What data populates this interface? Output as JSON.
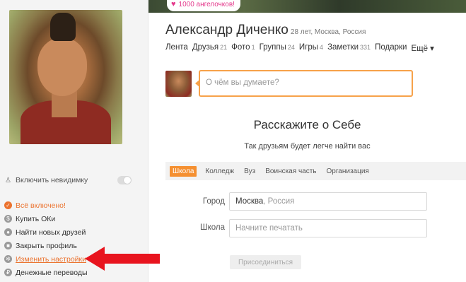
{
  "banner": {
    "badge_label": "1000 ангелочков!"
  },
  "profile": {
    "name": "Александр Диченко",
    "meta": "28 лет, Москва, Россия"
  },
  "nav": {
    "tabs": [
      {
        "label": "Лента",
        "count": ""
      },
      {
        "label": "Друзья",
        "count": "21"
      },
      {
        "label": "Фото",
        "count": "1"
      },
      {
        "label": "Группы",
        "count": "24"
      },
      {
        "label": "Игры",
        "count": "4"
      },
      {
        "label": "Заметки",
        "count": "331"
      },
      {
        "label": "Подарки",
        "count": ""
      },
      {
        "label": "Ещё ▾",
        "count": ""
      }
    ]
  },
  "status": {
    "placeholder": "О чём вы думаете?"
  },
  "sidebar": {
    "invisible_label": "Включить невидимку",
    "menu": [
      {
        "label": "Всё включено!",
        "icon": "ok-icon"
      },
      {
        "label": "Купить ОКи",
        "icon": "coin-icon"
      },
      {
        "label": "Найти новых друзей",
        "icon": "user-icon"
      },
      {
        "label": "Закрыть профиль",
        "icon": "lock-icon"
      },
      {
        "label": "Изменить настройки",
        "icon": "gear-icon"
      },
      {
        "label": "Денежные переводы",
        "icon": "money-icon"
      }
    ]
  },
  "about": {
    "title": "Расскажите о Себе",
    "subtitle": "Так друзьям будет легче найти вас",
    "tabs": [
      "Школа",
      "Колледж",
      "Вуз",
      "Воинская часть",
      "Организация"
    ],
    "city_label": "Город",
    "city_value": "Москва",
    "city_country": ", Россия",
    "school_label": "Школа",
    "school_placeholder": "Начните печатать",
    "join_label": "Присоединиться"
  },
  "colors": {
    "accent": "#eb722e",
    "arrow": "#e8141e"
  }
}
